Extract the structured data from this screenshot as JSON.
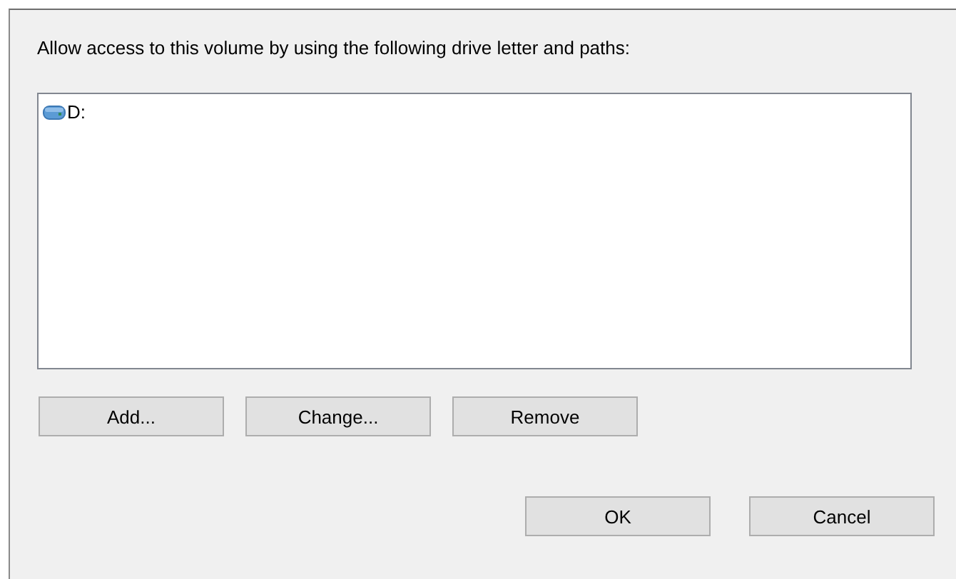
{
  "instruction": "Allow access to this volume by using the following drive letter and paths:",
  "paths": [
    {
      "label": "D:"
    }
  ],
  "path_buttons": [
    "Add...",
    "Change...",
    "Remove"
  ],
  "dialog_buttons": [
    "OK",
    "Cancel"
  ]
}
